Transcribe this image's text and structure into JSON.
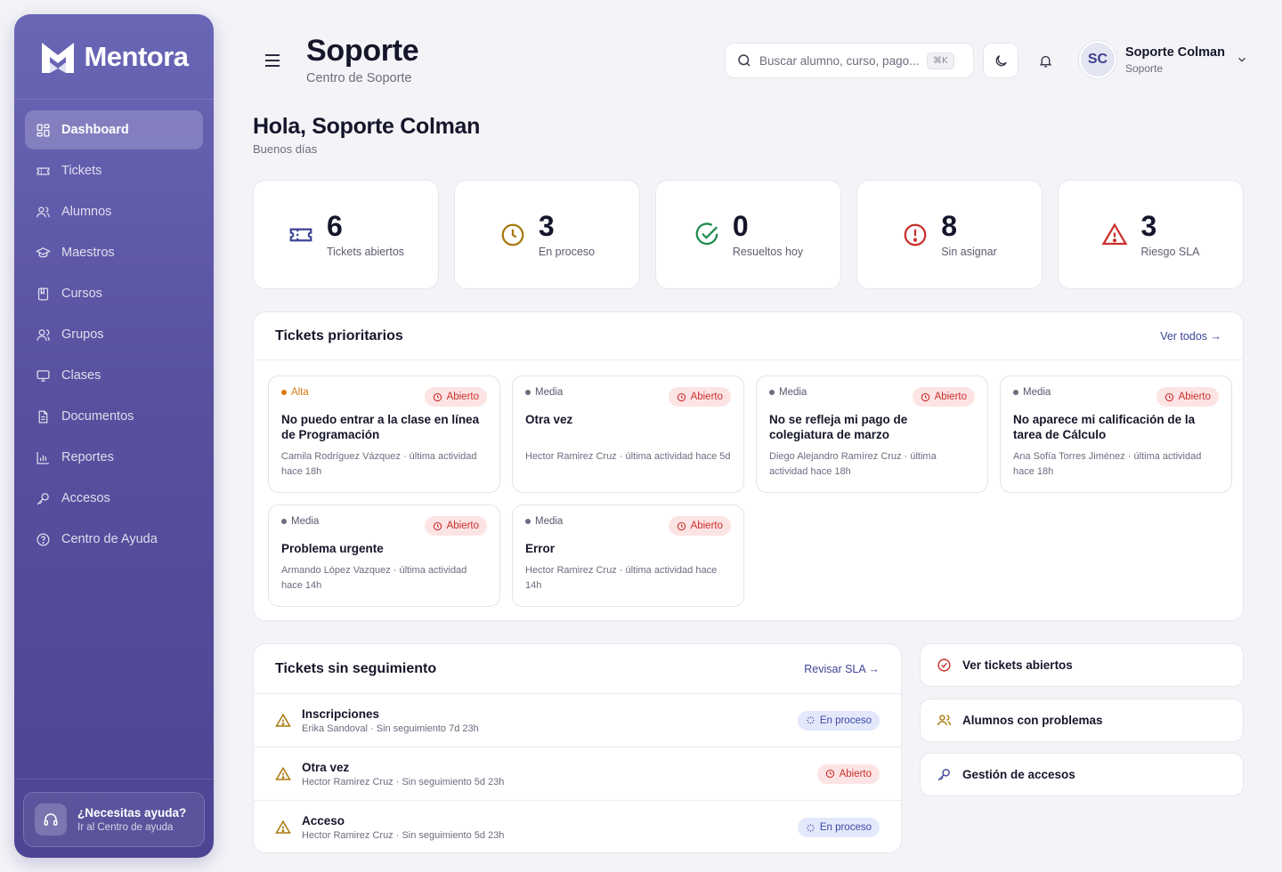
{
  "brand": {
    "name": "Mentora"
  },
  "sidebar": {
    "items": [
      {
        "label": "Dashboard",
        "icon": "dashboard-icon",
        "active": true
      },
      {
        "label": "Tickets",
        "icon": "ticket-icon"
      },
      {
        "label": "Alumnos",
        "icon": "users-icon"
      },
      {
        "label": "Maestros",
        "icon": "graduation-cap-icon"
      },
      {
        "label": "Cursos",
        "icon": "book-icon"
      },
      {
        "label": "Grupos",
        "icon": "group-icon"
      },
      {
        "label": "Clases",
        "icon": "monitor-icon"
      },
      {
        "label": "Documentos",
        "icon": "document-icon"
      },
      {
        "label": "Reportes",
        "icon": "bar-chart-icon"
      },
      {
        "label": "Accesos",
        "icon": "key-icon"
      },
      {
        "label": "Centro de Ayuda",
        "icon": "help-circle-icon"
      }
    ],
    "help": {
      "title": "¿Necesitas ayuda?",
      "subtitle": "Ir al Centro de ayuda"
    }
  },
  "header": {
    "title": "Soporte",
    "subtitle": "Centro de Soporte",
    "search_placeholder": "Buscar alumno, curso, pago...",
    "search_shortcut": "⌘K",
    "user": {
      "initials": "SC",
      "name": "Soporte Colman",
      "role": "Soporte"
    }
  },
  "greeting": {
    "title": "Hola, Soporte Colman",
    "subtitle": "Buenos días"
  },
  "stats": [
    {
      "value": "6",
      "label": "Tickets abiertos",
      "icon": "ticket-icon",
      "color": "#3f4596"
    },
    {
      "value": "3",
      "label": "En proceso",
      "icon": "clock-icon",
      "color": "#a8780c"
    },
    {
      "value": "0",
      "label": "Resueltos hoy",
      "icon": "check-circle-icon",
      "color": "#1e8a4c"
    },
    {
      "value": "8",
      "label": "Sin asignar",
      "icon": "alert-circle-icon",
      "color": "#c9302c"
    },
    {
      "value": "3",
      "label": "Riesgo SLA",
      "icon": "warning-triangle-icon",
      "color": "#c9302c"
    }
  ],
  "priority": {
    "title": "Tickets prioritarios",
    "link": "Ver todos →",
    "tickets": [
      {
        "priority": "Alta",
        "status": "Abierto",
        "title": "No puedo entrar a la clase en línea de Programación",
        "meta": "Camila Rodríguez Vázquez · última actividad hace 18h"
      },
      {
        "priority": "Media",
        "status": "Abierto",
        "title": "Otra vez",
        "meta": "Hector Ramirez Cruz · última actividad hace 5d"
      },
      {
        "priority": "Media",
        "status": "Abierto",
        "title": "No se refleja mi pago de colegiatura de marzo",
        "meta": "Diego Alejandro Ramírez Cruz · última actividad hace 18h"
      },
      {
        "priority": "Media",
        "status": "Abierto",
        "title": "No aparece mi calificación de la tarea de Cálculo",
        "meta": "Ana Sofía Torres Jiménez · última actividad hace 18h"
      },
      {
        "priority": "Media",
        "status": "Abierto",
        "title": "Problema urgente",
        "meta": "Armando López Vazquez · última actividad hace 14h"
      },
      {
        "priority": "Media",
        "status": "Abierto",
        "title": "Error",
        "meta": "Hector Ramirez Cruz · última actividad hace 14h"
      }
    ]
  },
  "followup": {
    "title": "Tickets sin seguimiento",
    "link": "Revisar SLA →",
    "rows": [
      {
        "title": "Inscripciones",
        "sub": "Erika Sandoval · Sin seguimiento 7d 23h",
        "status": "En proceso"
      },
      {
        "title": "Otra vez",
        "sub": "Hector Ramirez Cruz · Sin seguimiento 5d 23h",
        "status": "Abierto"
      },
      {
        "title": "Acceso",
        "sub": "Hector Ramirez Cruz · Sin seguimiento 5d 23h",
        "status": "En proceso"
      }
    ]
  },
  "quick_actions": [
    {
      "label": "Ver tickets abiertos",
      "icon": "check-circle-icon"
    },
    {
      "label": "Alumnos con problemas",
      "icon": "users-icon"
    },
    {
      "label": "Gestión de accesos",
      "icon": "key-icon"
    }
  ]
}
